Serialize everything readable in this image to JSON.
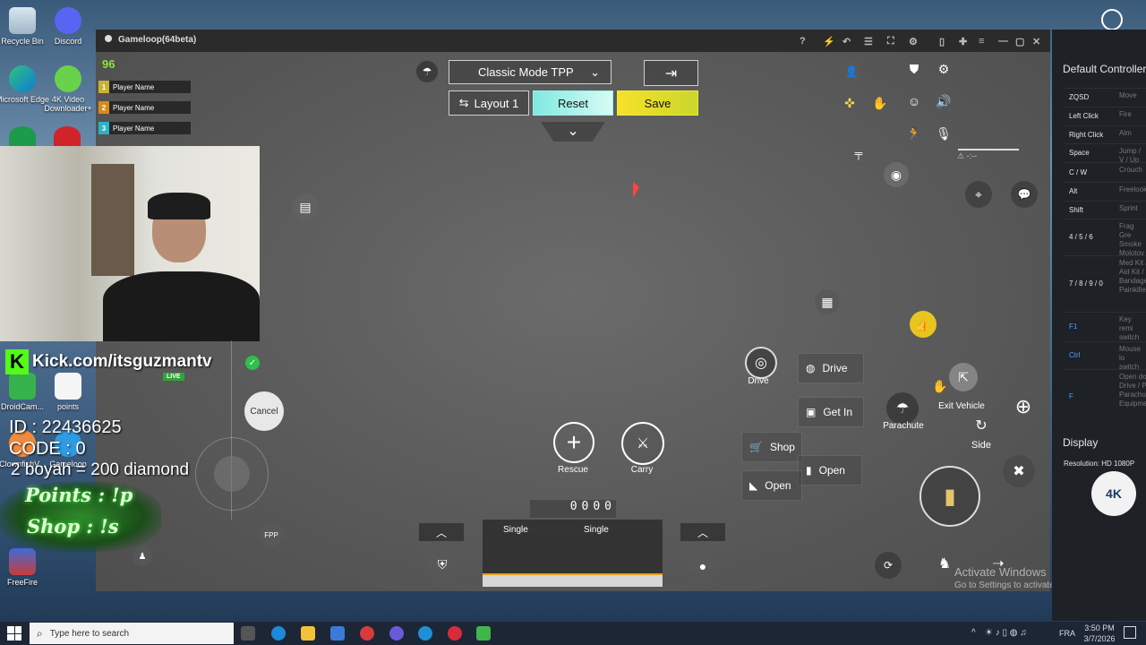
{
  "desktop": {
    "icons": [
      {
        "label": "Recycle Bin",
        "name": "recycle-bin-icon"
      },
      {
        "label": "Discord",
        "name": "discord-icon"
      },
      {
        "label": "Microsoft Edge",
        "name": "edge-icon"
      },
      {
        "label": "4K Video Downloader+",
        "name": "4k-video-downloader-icon"
      },
      {
        "label": "DroidCam...",
        "name": "droidcam-icon"
      },
      {
        "label": "points",
        "name": "points-file-icon"
      },
      {
        "label": "ClownfishV...",
        "name": "clownfish-icon"
      },
      {
        "label": "Gameloop",
        "name": "gameloop-icon"
      },
      {
        "label": "FreeFire",
        "name": "freefire-icon"
      }
    ],
    "watermark_line1": "Activate Windows",
    "watermark_line2": "Go to Settings to activate Windows."
  },
  "stream_overlay": {
    "kick_text": "Kick.com/itsguzmantv",
    "live_badge": "LIVE",
    "id_text": "ID : 22436625",
    "code_text": "CODE : 0",
    "boyah_text": "2 boyah = 200 diamond",
    "points_text": "Points : !p",
    "shop_text": "Shop : !s"
  },
  "window": {
    "title": "Gameloop(64beta)",
    "titlebar_icons": [
      "help-icon",
      "flash-icon",
      "undo-icon",
      "list-icon",
      "fullscreen-icon",
      "settings-icon",
      "sidebar-icon",
      "pin-icon",
      "menu-icon",
      "minimize-icon",
      "maximize-icon",
      "close-icon"
    ]
  },
  "game": {
    "counter": "96",
    "players": [
      {
        "num": "1",
        "name": "Player Name",
        "color": "#c9b233"
      },
      {
        "num": "2",
        "name": "Player Name",
        "color": "#d68b1c"
      },
      {
        "num": "3",
        "name": "Player Name",
        "color": "#2bb3c4"
      }
    ],
    "mode_select": "Classic Mode TPP",
    "layout_button": "Layout 1",
    "reset_button": "Reset",
    "save_button": "Save",
    "cancel_button": "Cancel",
    "fpp_button": "FPP",
    "rescue_label": "Rescue",
    "carry_label": "Carry",
    "ammo_counter": "0000",
    "fire_mode_left": "Single",
    "fire_mode_right": "Single",
    "drive_label": "Drive",
    "actions": [
      {
        "label": "Drive",
        "name": "drive-action"
      },
      {
        "label": "Get In",
        "name": "get-in-action"
      },
      {
        "label": "Shop",
        "name": "shop-action"
      },
      {
        "label": "Open",
        "name": "open-action-door"
      },
      {
        "label": "Open",
        "name": "open-action-crate"
      }
    ],
    "parachute_label": "Parachute",
    "exit_vehicle_label": "Exit Vehicle",
    "side_label": "Side"
  },
  "panel": {
    "title": "Default Controller",
    "rows": [
      {
        "key": "ZQSD",
        "value": "Move"
      },
      {
        "key": "Left Click",
        "value": "Fire"
      },
      {
        "key": "Right Click",
        "value": "Aim"
      },
      {
        "key": "Space",
        "value": "Jump / V / Up"
      },
      {
        "key": "C / W",
        "value": "Crouch"
      },
      {
        "key": "Alt",
        "value": "Freelook"
      },
      {
        "key": "Shift",
        "value": "Sprint"
      },
      {
        "key": "4 / 5 / 6",
        "value": "Frag Gre Smoke Molotov"
      },
      {
        "key": "7 / 8 / 9 / 0",
        "value": "Med Kit / Aid Kit / Bandage Painkille"
      },
      {
        "key": "F1",
        "value": "Key remi switch"
      },
      {
        "key": "Ctrl",
        "value": "Mouse lo switch"
      },
      {
        "key": "F",
        "value": "Open do Drive / P Parachu Equipme"
      }
    ],
    "display_title": "Display",
    "resolution": "Resolution: HD 1080P"
  },
  "taskbar": {
    "search_placeholder": "Type here to search",
    "lang": "FRA",
    "time": "3:50 PM",
    "date": "3/7/2026"
  }
}
